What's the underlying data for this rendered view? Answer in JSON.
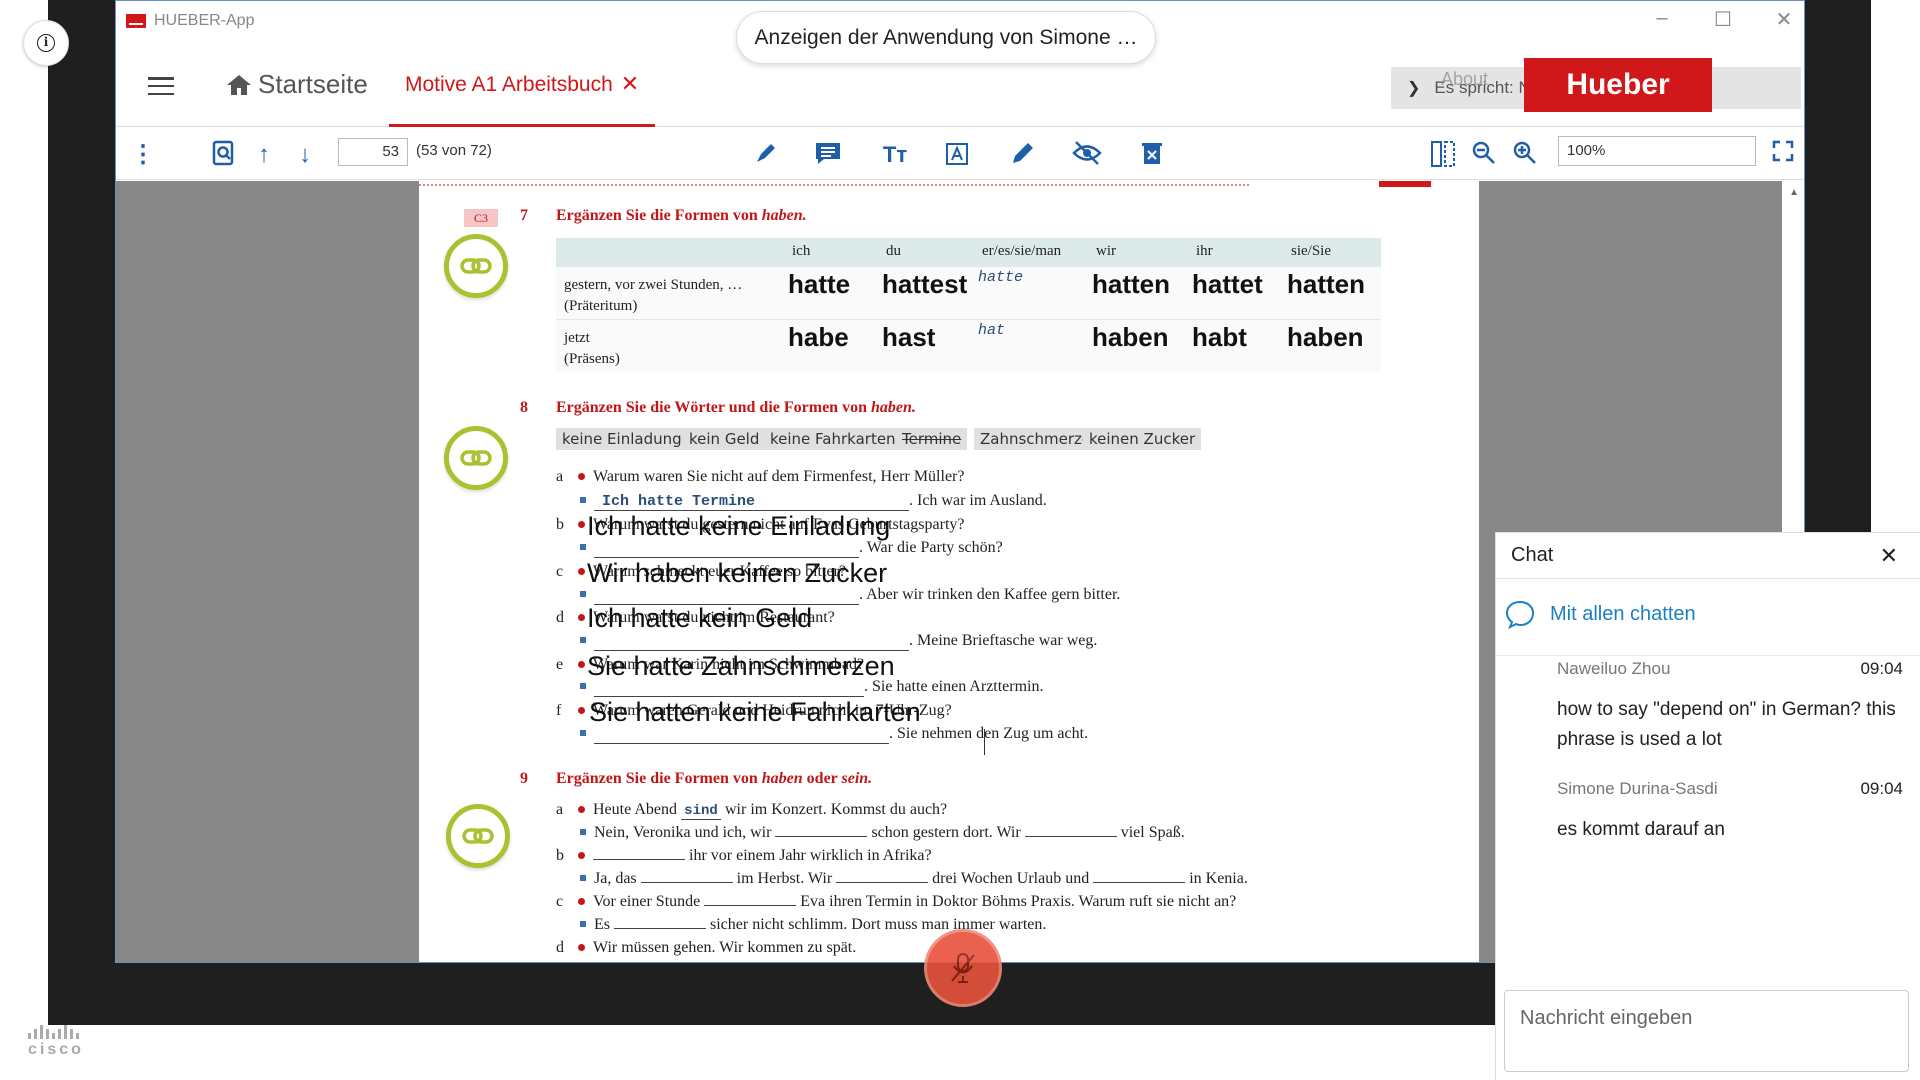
{
  "meeting": {
    "share_banner": "Anzeigen der Anwendung von Simone …",
    "info_icon": "info-icon",
    "brand": "cisco",
    "mute_icon": "microphone-muted-icon"
  },
  "window": {
    "title": "HUEBER-App",
    "controls": [
      "–",
      "☐",
      "✕"
    ]
  },
  "navbar": {
    "home_label": "Startseite",
    "active_tab": "Motive A1 Arbeitsbuch",
    "speaking": "Es spricht: Naweiluo Zhou",
    "about": "About",
    "logo": "Hueber"
  },
  "pdf_toolbar": {
    "page": "53",
    "page_count": "(53 von 72)",
    "zoom": "100%"
  },
  "worksheet": {
    "c3": "C3",
    "ex7": {
      "num": "7",
      "head_prefix": "Ergänzen Sie die Formen von ",
      "head_word": "haben.",
      "columns": [
        "",
        "ich",
        "du",
        "er/es/sie/man",
        "wir",
        "ihr",
        "sie/Sie"
      ],
      "rows": [
        {
          "label1": "gestern, vor zwei Stunden, …",
          "label2": "(Präteritum)",
          "ich": "hatte",
          "du": "hattest",
          "er": "hatte",
          "wir": "hatten",
          "ihr": "hattet",
          "sie": "hatten"
        },
        {
          "label1": "jetzt",
          "label2": "(Präsens)",
          "ich": "habe",
          "du": "hast",
          "er": "hat",
          "wir": "haben",
          "ihr": "habt",
          "sie": "haben"
        }
      ]
    },
    "ex8": {
      "num": "8",
      "head_prefix": "Ergänzen Sie die Wörter und die Formen von ",
      "head_word": "haben.",
      "words": [
        "keine Einladung",
        "kein Geld",
        "keine Fahrkarten",
        "Termine",
        "Zahnschmerzen",
        "keinen Zucker"
      ],
      "items": [
        {
          "lbl": "a",
          "q": "Warum waren Sie nicht auf dem Firmenfest, Herr Müller?",
          "ans": "Ich hatte Termine",
          "rest": ". Ich war im Ausland."
        },
        {
          "lbl": "b",
          "q": "Warum warst du gestern nicht auf Evas Geburtstagsparty?",
          "ans": "Ich hatte keine Einladung",
          "rest": ". War die Party schön?"
        },
        {
          "lbl": "c",
          "q": "Warum schmeckt euer Kaffee so bitter?",
          "ans": "Wir haben keinen Zucker",
          "rest": ". Aber wir trinken den Kaffee gern bitter."
        },
        {
          "lbl": "d",
          "q": "Warum warst du nicht im Restaurant?",
          "ans": "Ich hatte kein Geld",
          "rest": ". Meine Brieftasche war weg."
        },
        {
          "lbl": "e",
          "q": "Warum war Karin nicht im Schwimmbad?",
          "ans": "Sie hatte Zahnschmerzen",
          "rest": ". Sie hatte einen Arzttermin."
        },
        {
          "lbl": "f",
          "q": "Warum waren Gerald und Heidrun nicht im 7-Uhr-Zug?",
          "ans": "Sie hatten keine Fahrkarten",
          "rest": ". Sie nehmen den Zug um acht."
        }
      ]
    },
    "ex9": {
      "num": "9",
      "head_prefix": "Ergänzen Sie die Formen von ",
      "head_word1": "haben",
      "head_mid": " oder ",
      "head_word2": "sein.",
      "a1_pre": "Heute Abend",
      "a1_ans": "sind",
      "a1_post": "wir im Konzert. Kommst du auch?",
      "a2_pre": "Nein, Veronika und ich, wir",
      "a2_mid": "schon gestern dort. Wir",
      "a2_post": "viel Spaß.",
      "b1_post": "ihr vor einem Jahr wirklich in Afrika?",
      "b2_pre": "Ja, das",
      "b2_mid1": "im Herbst. Wir",
      "b2_mid2": "drei Wochen Urlaub und",
      "b2_post": "in Kenia.",
      "c1_pre": "Vor einer Stunde",
      "c1_post": "Eva ihren Termin in Doktor Böhms Praxis. Warum ruft sie nicht an?",
      "c2_pre": "Es",
      "c2_post": "sicher nicht schlimm. Dort muss man immer warten.",
      "d1": "Wir müssen gehen. Wir kommen zu spät."
    }
  },
  "chat": {
    "title": "Chat",
    "all_label": "Mit allen chatten",
    "messages": [
      {
        "name": "Naweiluo Zhou",
        "time": "09:04",
        "text": "how to say \"depend on\" in German? this phrase is used a lot"
      },
      {
        "name": "Simone Durina-Sasdi",
        "time": "09:04",
        "text": "es kommt darauf an"
      }
    ],
    "input_placeholder": "Nachricht eingeben"
  },
  "colors": {
    "accent": "#d0181b",
    "toolbar_icon": "#1f5fa8",
    "chat_link": "#1c7fc2",
    "mute": "#e8523c"
  }
}
